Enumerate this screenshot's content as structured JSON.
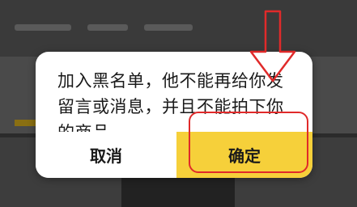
{
  "dialog": {
    "message": "加入黑名单，他不能再给你发留言或消息，并且不能拍下你的商品",
    "cancel_label": "取消",
    "confirm_label": "确定"
  },
  "colors": {
    "confirm_button": "#f6d03a",
    "dialog_background": "#ffffff",
    "annotation": "#e02a2a",
    "overlay": "#2b2b2b"
  },
  "annotation": {
    "arrow_icon": "down-arrow-outline-icon",
    "highlight": "confirm-button-highlight"
  }
}
